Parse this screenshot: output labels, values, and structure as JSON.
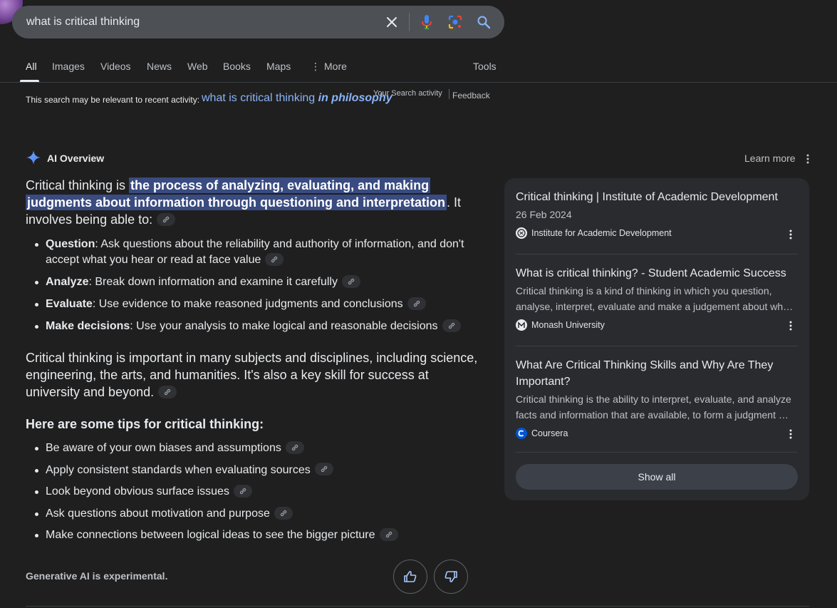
{
  "search": {
    "query": "what is critical thinking",
    "clear_icon": "close-icon",
    "voice_icon": "mic-icon",
    "lens_icon": "lens-icon",
    "search_icon": "search-icon"
  },
  "tabs": [
    {
      "label": "All",
      "active": true
    },
    {
      "label": "Images"
    },
    {
      "label": "Videos"
    },
    {
      "label": "News"
    },
    {
      "label": "Web"
    },
    {
      "label": "Books"
    },
    {
      "label": "Maps"
    },
    {
      "label": "More"
    }
  ],
  "tools_label": "Tools",
  "recent": {
    "label": "This search may be relevant to recent activity:",
    "link_plain": "what is critical thinking",
    "link_bold": "in philosophy",
    "activity": "Your Search activity",
    "feedback": "Feedback"
  },
  "ai": {
    "title": "AI Overview",
    "learn_more": "Learn more",
    "intro_pre": "Critical thinking is ",
    "intro_hl_1": "the process of analyzing, evaluating, and making",
    "intro_hl_2": "judgments about information through questioning and interpretation",
    "intro_post_1": ". It",
    "intro_post_2": "involves being able to:",
    "bullets": [
      {
        "term": "Question",
        "text": ": Ask questions about the reliability and authority of information, and don't accept what you hear or read at face value"
      },
      {
        "term": "Analyze",
        "text": ": Break down information and examine it carefully"
      },
      {
        "term": "Evaluate",
        "text": ": Use evidence to make reasoned judgments and conclusions"
      },
      {
        "term": "Make decisions",
        "text": ": Use your analysis to make logical and reasonable decisions"
      }
    ],
    "para2": "Critical thinking is important in many subjects and disciplines, including science, engineering, the arts, and humanities. It's also a key skill for success at university and beyond.",
    "tips_title": "Here are some tips for critical thinking:",
    "tips": [
      "Be aware of your own biases and assumptions",
      "Apply consistent standards when evaluating sources",
      "Look beyond obvious surface issues",
      "Ask questions about motivation and purpose",
      "Make connections between logical ideas to see the bigger picture"
    ],
    "gen_note": "Generative AI is experimental."
  },
  "sources": [
    {
      "title": "Critical thinking | Institute of Academic Development",
      "date": "26 Feb 2024",
      "site": "Institute for Academic Development"
    },
    {
      "title": "What is critical thinking? - Student Academic Success",
      "snippet_1": "Critical thinking is a kind of thinking in which you question,",
      "snippet_2": "analyse, interpret, evaluate and make a judgement about wh…",
      "site": "Monash University"
    },
    {
      "title_1": "What Are Critical Thinking Skills and Why Are They",
      "title_2": "Important?",
      "snippet_1": "Critical thinking is the ability to interpret, evaluate, and analyze",
      "snippet_2": "facts and information that are available, to form a judgment …",
      "site": "Coursera"
    }
  ],
  "show_all": "Show all",
  "colors": {
    "background": "#1f1f1f",
    "search_bar": "#4d5156",
    "highlight": "#394b80",
    "link": "#8ab4f8",
    "panel": "#2a2b2f"
  }
}
